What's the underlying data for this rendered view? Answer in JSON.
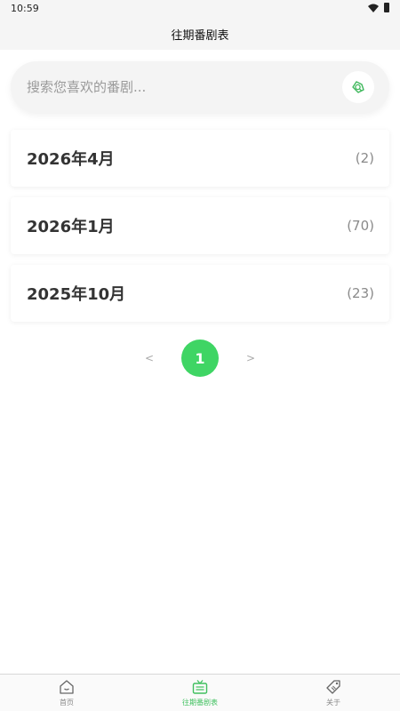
{
  "status_bar": {
    "time": "10:59"
  },
  "header": {
    "title": "往期番剧表"
  },
  "search": {
    "placeholder": "搜索您喜欢的番剧..."
  },
  "seasons": [
    {
      "title": "2026年4月",
      "count": "(2)"
    },
    {
      "title": "2026年1月",
      "count": "(70)"
    },
    {
      "title": "2025年10月",
      "count": "(23)"
    }
  ],
  "pagination": {
    "prev": "<",
    "current": "1",
    "next": ">"
  },
  "bottom_nav": {
    "items": [
      {
        "label": "首页",
        "icon": "home-icon",
        "active": false
      },
      {
        "label": "往期番剧表",
        "icon": "tv-icon",
        "active": true
      },
      {
        "label": "关于",
        "icon": "tag-icon",
        "active": false
      }
    ]
  },
  "colors": {
    "accent": "#3fd564",
    "background": "#ffffff",
    "header_bg": "#f5f5f5"
  }
}
